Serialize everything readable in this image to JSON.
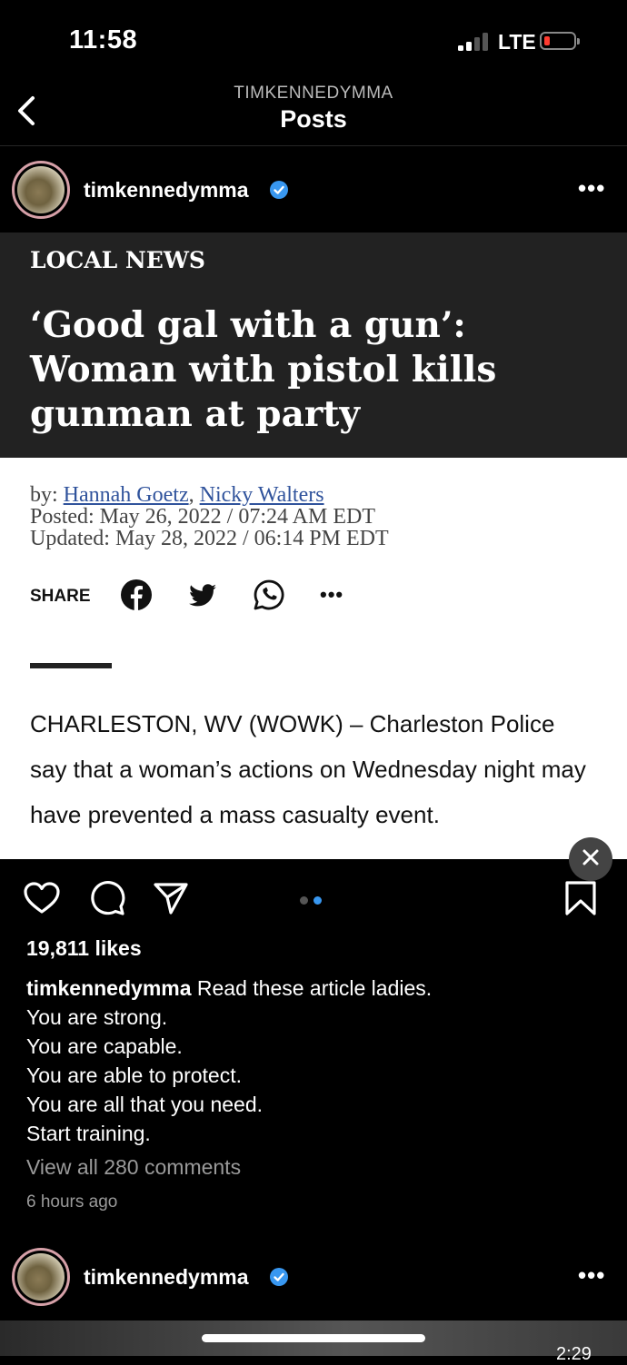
{
  "status_bar": {
    "time": "11:58",
    "network": "LTE"
  },
  "nav": {
    "subtitle": "TIMKENNEDYMMA",
    "title": "Posts"
  },
  "post": {
    "username": "timkennedymma",
    "article": {
      "section": "LOCAL NEWS",
      "headline": "‘Good gal with a gun’: Woman with pistol kills gunman at party",
      "by_prefix": "by: ",
      "author1": "Hannah Goetz",
      "author_sep": ", ",
      "author2": "Nicky Walters",
      "posted": "Posted: May 26, 2022 / 07:24 AM EDT",
      "updated": "Updated: May 28, 2022 / 06:14 PM EDT",
      "share_label": "SHARE",
      "body": "CHARLESTON, WV (WOWK) – Charleston Police say that a woman’s actions on Wednesday night may have prevented a mass casualty event."
    },
    "carousel": {
      "count": 2,
      "active": 2
    },
    "likes": "19,811 likes",
    "caption_user": "timkennedymma",
    "caption_lines": [
      "Read these article ladies.",
      "You are strong.",
      "You are capable.",
      "You are able to protect.",
      "You are all that you need.",
      "Start training."
    ],
    "view_comments": "View all 280 comments",
    "time_ago": "6 hours ago"
  },
  "next_post": {
    "username": "timkennedymma",
    "clip_time": "2:29"
  },
  "colors": {
    "verified": "#3897f0",
    "carousel_active": "#3897f0",
    "carousel_inactive": "#555555",
    "link": "#30539c"
  },
  "icons": [
    "back-chevron-icon",
    "verified-badge-icon",
    "more-icon",
    "facebook-icon",
    "twitter-icon",
    "whatsapp-icon",
    "close-icon",
    "heart-icon",
    "comment-icon",
    "send-icon",
    "bookmark-icon"
  ]
}
